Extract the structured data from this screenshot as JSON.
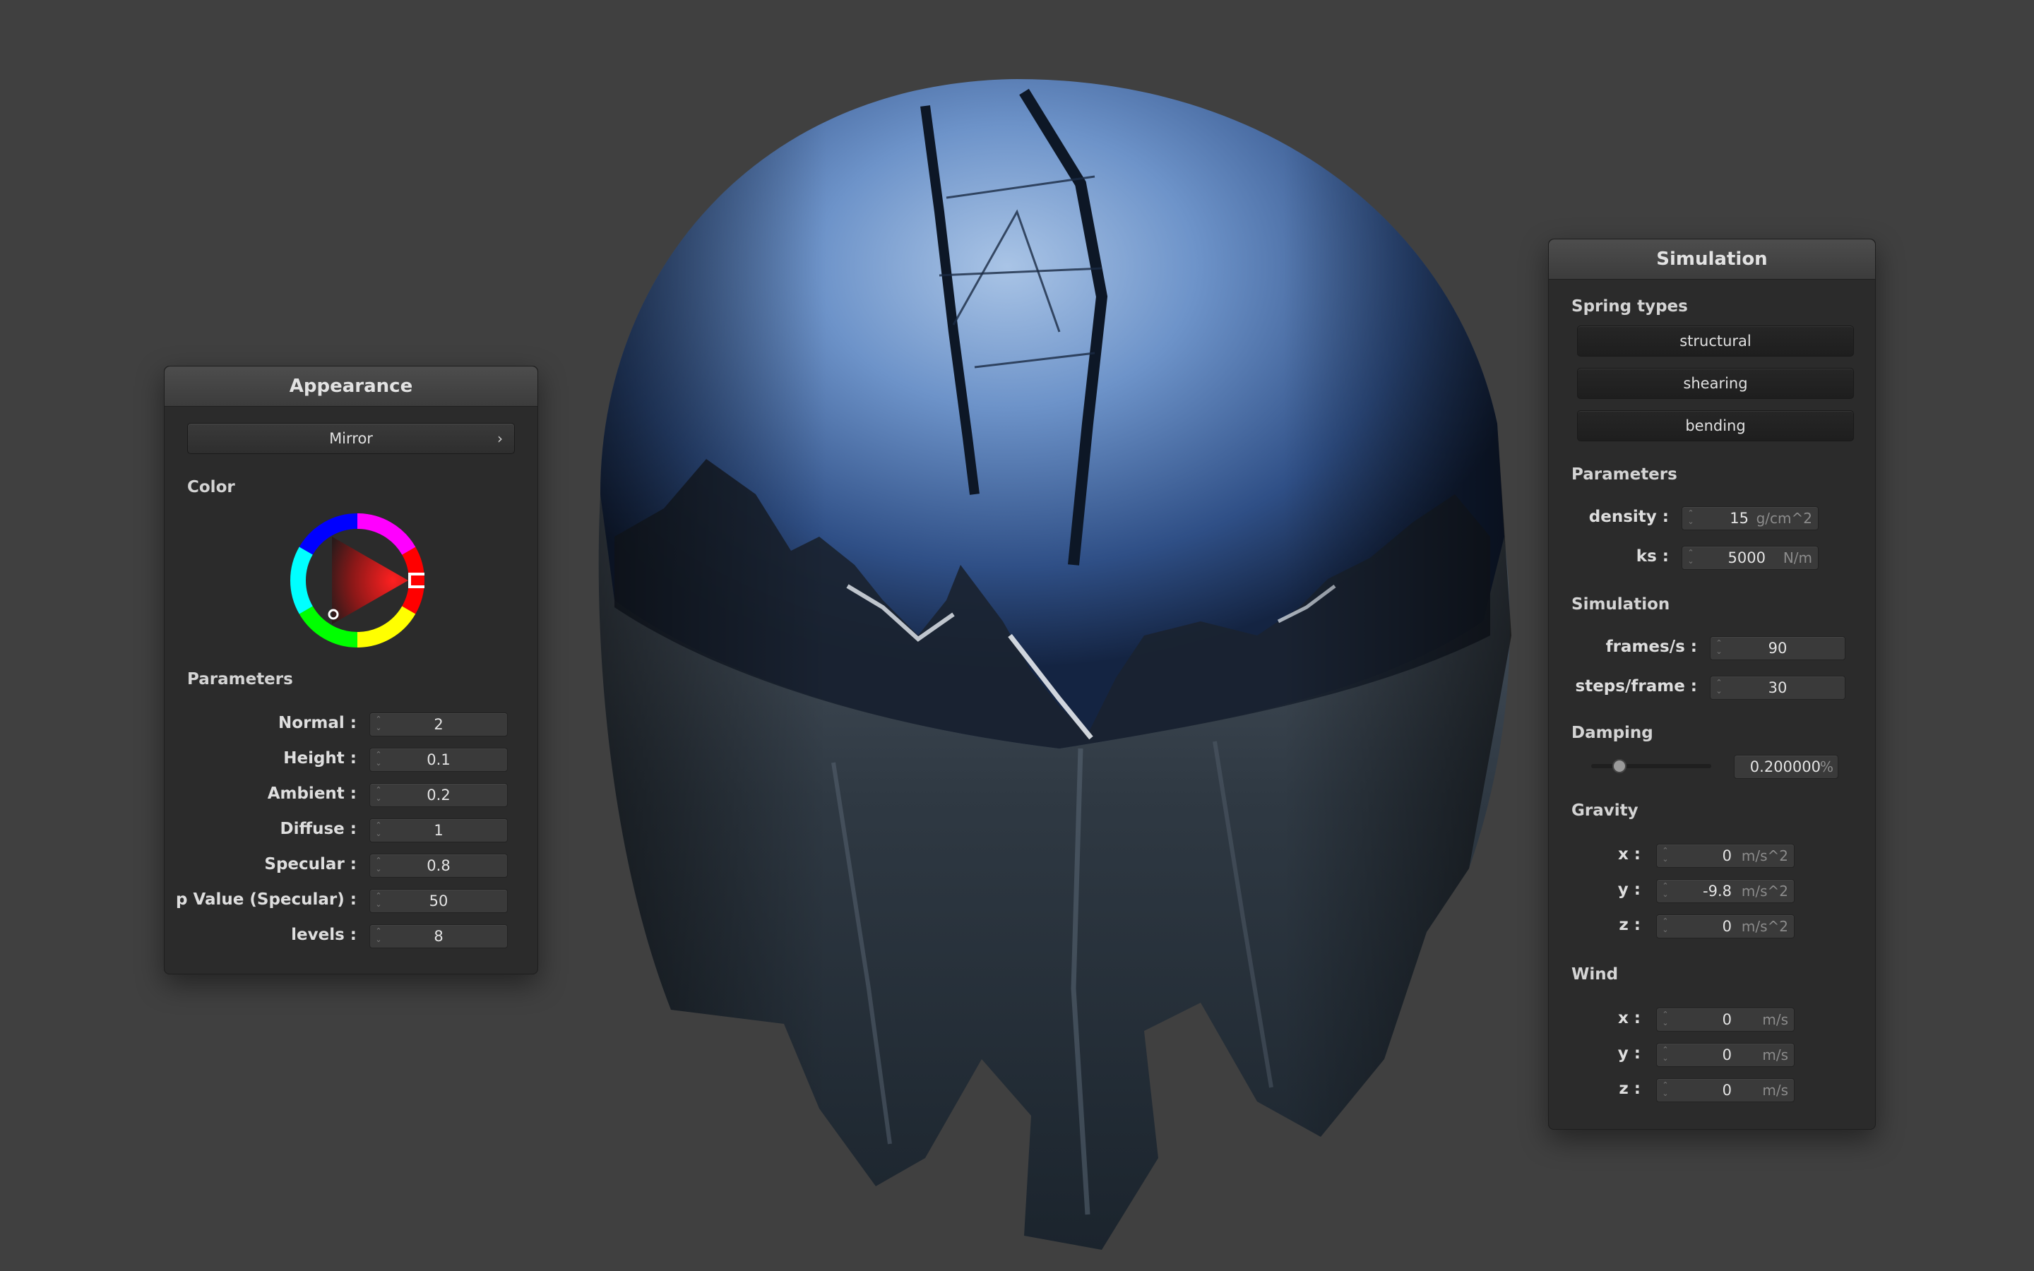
{
  "appearance": {
    "title": "Appearance",
    "material": "Mirror",
    "color_label": "Color",
    "parameters_label": "Parameters",
    "params": [
      {
        "label": "Normal :",
        "value": "2"
      },
      {
        "label": "Height :",
        "value": "0.1"
      },
      {
        "label": "Ambient :",
        "value": "0.2"
      },
      {
        "label": "Diffuse :",
        "value": "1"
      },
      {
        "label": "Specular :",
        "value": "0.8"
      },
      {
        "label": "p Value (Specular) :",
        "value": "50"
      },
      {
        "label": "levels :",
        "value": "8"
      }
    ],
    "color_selected": "#ff0000"
  },
  "simulation": {
    "title": "Simulation",
    "spring_types_label": "Spring types",
    "spring_buttons": [
      "structural",
      "shearing",
      "bending"
    ],
    "parameters_label": "Parameters",
    "density": {
      "label": "density :",
      "value": "15",
      "unit": "g/cm^2"
    },
    "ks": {
      "label": "ks :",
      "value": "5000",
      "unit": "N/m"
    },
    "simulation_label": "Simulation",
    "frames": {
      "label": "frames/s :",
      "value": "90"
    },
    "steps": {
      "label": "steps/frame :",
      "value": "30"
    },
    "damping_label": "Damping",
    "damping": {
      "value": "0.200000",
      "unit": "%",
      "slider_fraction": 0.2
    },
    "gravity_label": "Gravity",
    "gravity": [
      {
        "label": "x :",
        "value": "0",
        "unit": "m/s^2"
      },
      {
        "label": "y :",
        "value": "-9.8",
        "unit": "m/s^2"
      },
      {
        "label": "z :",
        "value": "0",
        "unit": "m/s^2"
      }
    ],
    "wind_label": "Wind",
    "wind": [
      {
        "label": "x :",
        "value": "0",
        "unit": "m/s"
      },
      {
        "label": "y :",
        "value": "0",
        "unit": "m/s"
      },
      {
        "label": "z :",
        "value": "0",
        "unit": "m/s"
      }
    ]
  }
}
